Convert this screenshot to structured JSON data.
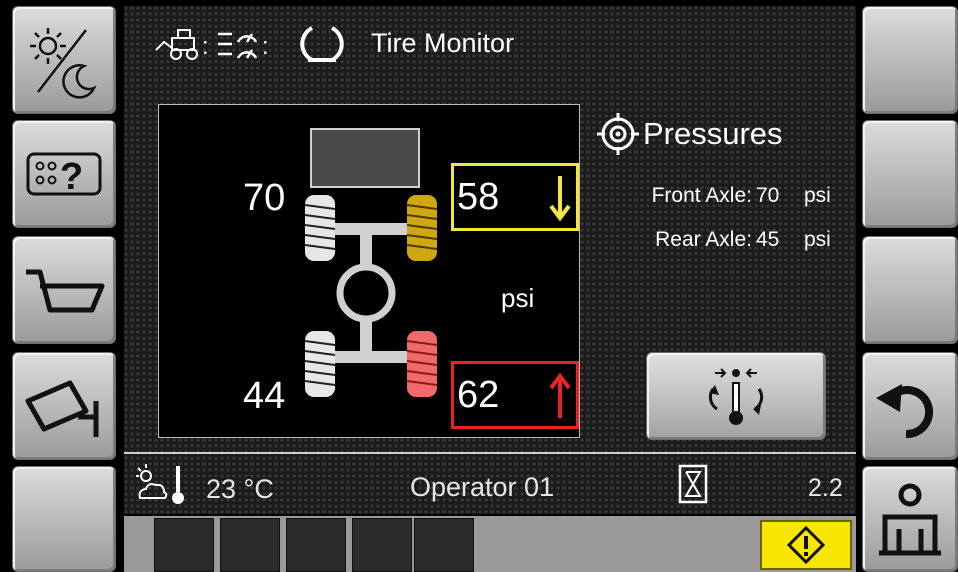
{
  "header": {
    "title": "Tire Monitor",
    "separator": ":"
  },
  "tires": {
    "front_left": "70",
    "front_right": "58",
    "rear_left": "44",
    "rear_right": "62",
    "unit": "psi",
    "front_right_status": "low",
    "rear_right_status": "high"
  },
  "pressures": {
    "title": "Pressures",
    "front_label": "Front Axle:",
    "front_value": "70",
    "rear_label": "Rear Axle:",
    "rear_value": "45",
    "unit": "psi"
  },
  "status_bar": {
    "temperature": "23 °C",
    "operator": "Operator 01",
    "version": "2.2"
  },
  "colors": {
    "warning_yellow": "#f5e63a",
    "alert_red": "#e8232a",
    "background": "#1b1b1b"
  },
  "icons": {
    "left_buttons": [
      "day-night-icon",
      "keypad-help-icon",
      "bucket-icon",
      "camera-icon",
      "blank"
    ],
    "right_buttons": [
      "blank",
      "blank",
      "blank",
      "undo-icon",
      "operator-icon"
    ],
    "status": [
      "weather-thermometer-icon",
      "hourglass-icon"
    ],
    "warning": "warning-diamond-icon"
  }
}
